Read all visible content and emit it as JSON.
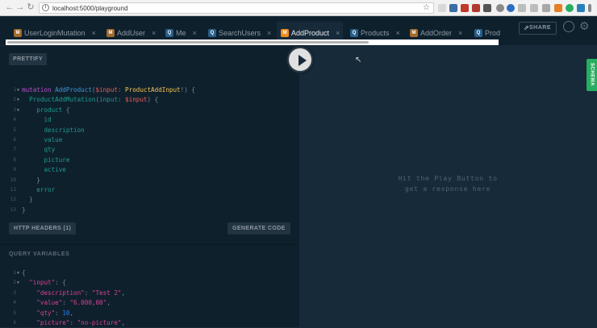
{
  "browser": {
    "url": "localhost:5000/playground",
    "nav": {
      "back": "←",
      "forward": "→",
      "reload": "↻"
    }
  },
  "tabs": [
    {
      "badge": "M",
      "label": "UserLoginMutation",
      "close": "×",
      "kind": "m"
    },
    {
      "badge": "M",
      "label": "AddUser",
      "close": "×",
      "kind": "m"
    },
    {
      "badge": "Q",
      "label": "Me",
      "close": "×",
      "kind": "q"
    },
    {
      "badge": "Q",
      "label": "SearchUsers",
      "close": "×",
      "kind": "q"
    },
    {
      "badge": "M",
      "label": "AddProduct",
      "close": "×",
      "kind": "m",
      "active": true
    },
    {
      "badge": "Q",
      "label": "Products",
      "close": "×",
      "kind": "q"
    },
    {
      "badge": "M",
      "label": "AddOrder",
      "close": "×",
      "kind": "m"
    },
    {
      "badge": "Q",
      "label": "Prod",
      "close": "",
      "kind": "q"
    }
  ],
  "header": {
    "share_label": "SHARE"
  },
  "editor": {
    "prettify_label": "PRETTIFY",
    "lines": [
      {
        "n": "1",
        "fold": true,
        "tokens": [
          [
            "kw",
            "mutation "
          ],
          [
            "fn",
            "AddProduct"
          ],
          [
            "pn",
            "("
          ],
          [
            "vr",
            "$input"
          ],
          [
            "pn",
            ": "
          ],
          [
            "ty",
            "ProductAddInput"
          ],
          [
            "pn",
            "!) {"
          ]
        ]
      },
      {
        "n": "2",
        "fold": true,
        "tokens": [
          [
            "pn",
            "  "
          ],
          [
            "fd",
            "ProductAddMutation"
          ],
          [
            "pn",
            "("
          ],
          [
            "fd",
            "input"
          ],
          [
            "pn",
            ": "
          ],
          [
            "vr",
            "$input"
          ],
          [
            "pn",
            ") {"
          ]
        ]
      },
      {
        "n": "3",
        "fold": true,
        "tokens": [
          [
            "pn",
            "    "
          ],
          [
            "fd",
            "product"
          ],
          [
            "pn",
            " {"
          ]
        ]
      },
      {
        "n": "4",
        "tokens": [
          [
            "pn",
            "      "
          ],
          [
            "fd",
            "id"
          ]
        ]
      },
      {
        "n": "5",
        "tokens": [
          [
            "pn",
            "      "
          ],
          [
            "fd",
            "description"
          ]
        ]
      },
      {
        "n": "6",
        "tokens": [
          [
            "pn",
            "      "
          ],
          [
            "fd",
            "value"
          ]
        ]
      },
      {
        "n": "7",
        "tokens": [
          [
            "pn",
            "      "
          ],
          [
            "fd",
            "qty"
          ]
        ]
      },
      {
        "n": "8",
        "tokens": [
          [
            "pn",
            "      "
          ],
          [
            "fd",
            "picture"
          ]
        ]
      },
      {
        "n": "9",
        "tokens": [
          [
            "pn",
            "      "
          ],
          [
            "fd",
            "active"
          ]
        ]
      },
      {
        "n": "10",
        "tokens": [
          [
            "pn",
            "    }"
          ]
        ]
      },
      {
        "n": "11",
        "tokens": [
          [
            "pn",
            "    "
          ],
          [
            "fd",
            "error"
          ]
        ]
      },
      {
        "n": "12",
        "tokens": [
          [
            "pn",
            "  }"
          ]
        ]
      },
      {
        "n": "13",
        "tokens": [
          [
            "pn",
            "}"
          ]
        ]
      }
    ]
  },
  "result": {
    "placeholder_line1": "Hit the Play Button to",
    "placeholder_line2": "get a response here",
    "schema_label": "SCHEMA"
  },
  "actions": {
    "http_headers_label": "HTTP HEADERS (1)",
    "generate_code_label": "GENERATE CODE"
  },
  "query_variables": {
    "title": "QUERY VARIABLES",
    "lines": [
      {
        "n": "1",
        "fold": true,
        "tokens": [
          [
            "pn",
            "{"
          ]
        ]
      },
      {
        "n": "2",
        "fold": true,
        "tokens": [
          [
            "pn",
            "  "
          ],
          [
            "st",
            "\"input\""
          ],
          [
            "pn",
            ": {"
          ]
        ]
      },
      {
        "n": "3",
        "tokens": [
          [
            "pn",
            "    "
          ],
          [
            "st",
            "\"description\""
          ],
          [
            "pn",
            ": "
          ],
          [
            "st",
            "\"Test 2\""
          ],
          [
            "pn",
            ","
          ]
        ]
      },
      {
        "n": "4",
        "tokens": [
          [
            "pn",
            "    "
          ],
          [
            "st",
            "\"value\""
          ],
          [
            "pn",
            ": "
          ],
          [
            "st",
            "\"6.000,00\""
          ],
          [
            "pn",
            ","
          ]
        ]
      },
      {
        "n": "5",
        "tokens": [
          [
            "pn",
            "    "
          ],
          [
            "st",
            "\"qty\""
          ],
          [
            "pn",
            ": "
          ],
          [
            "nm",
            "10"
          ],
          [
            "pn",
            ","
          ]
        ]
      },
      {
        "n": "6",
        "tokens": [
          [
            "pn",
            "    "
          ],
          [
            "st",
            "\"picture\""
          ],
          [
            "pn",
            ": "
          ],
          [
            "st",
            "\"no-picture\""
          ],
          [
            "pn",
            ","
          ]
        ]
      }
    ]
  },
  "colors": {
    "accent": "#f08d20",
    "schema_tab": "#27ae60",
    "background": "#172a3a"
  },
  "icons": [
    "back-icon",
    "forward-icon",
    "reload-icon",
    "lock-icon",
    "star-icon",
    "share-icon",
    "history-icon",
    "settings-gear-icon",
    "play-icon",
    "cursor-icon"
  ]
}
